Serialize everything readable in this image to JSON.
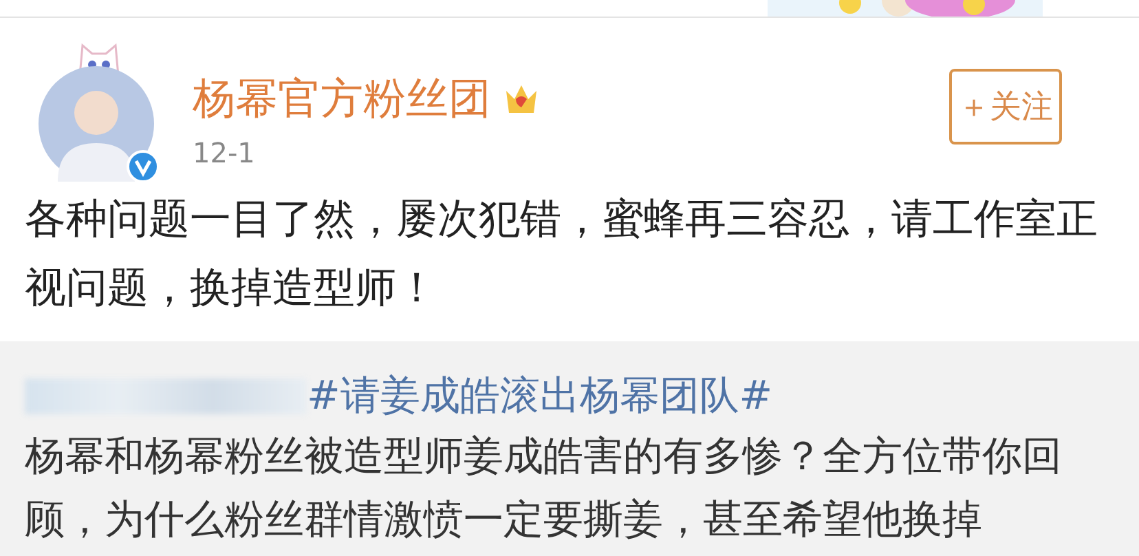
{
  "post": {
    "author": "杨幂官方粉丝团",
    "date": "12-1",
    "follow_button": "＋关注",
    "verified": true,
    "text": "各种问题一目了然，屡次犯错，蜜蜂再三容忍，请工作室正视问题，换掉造型师！"
  },
  "repost": {
    "hashtag": "#请姜成皓滚出杨幂团队#",
    "text": "杨幂和杨幂粉丝被造型师姜成皓害的有多惨？全方位带你回顾，为什么粉丝群情激愤一定要撕姜，甚至希望他换掉"
  }
}
